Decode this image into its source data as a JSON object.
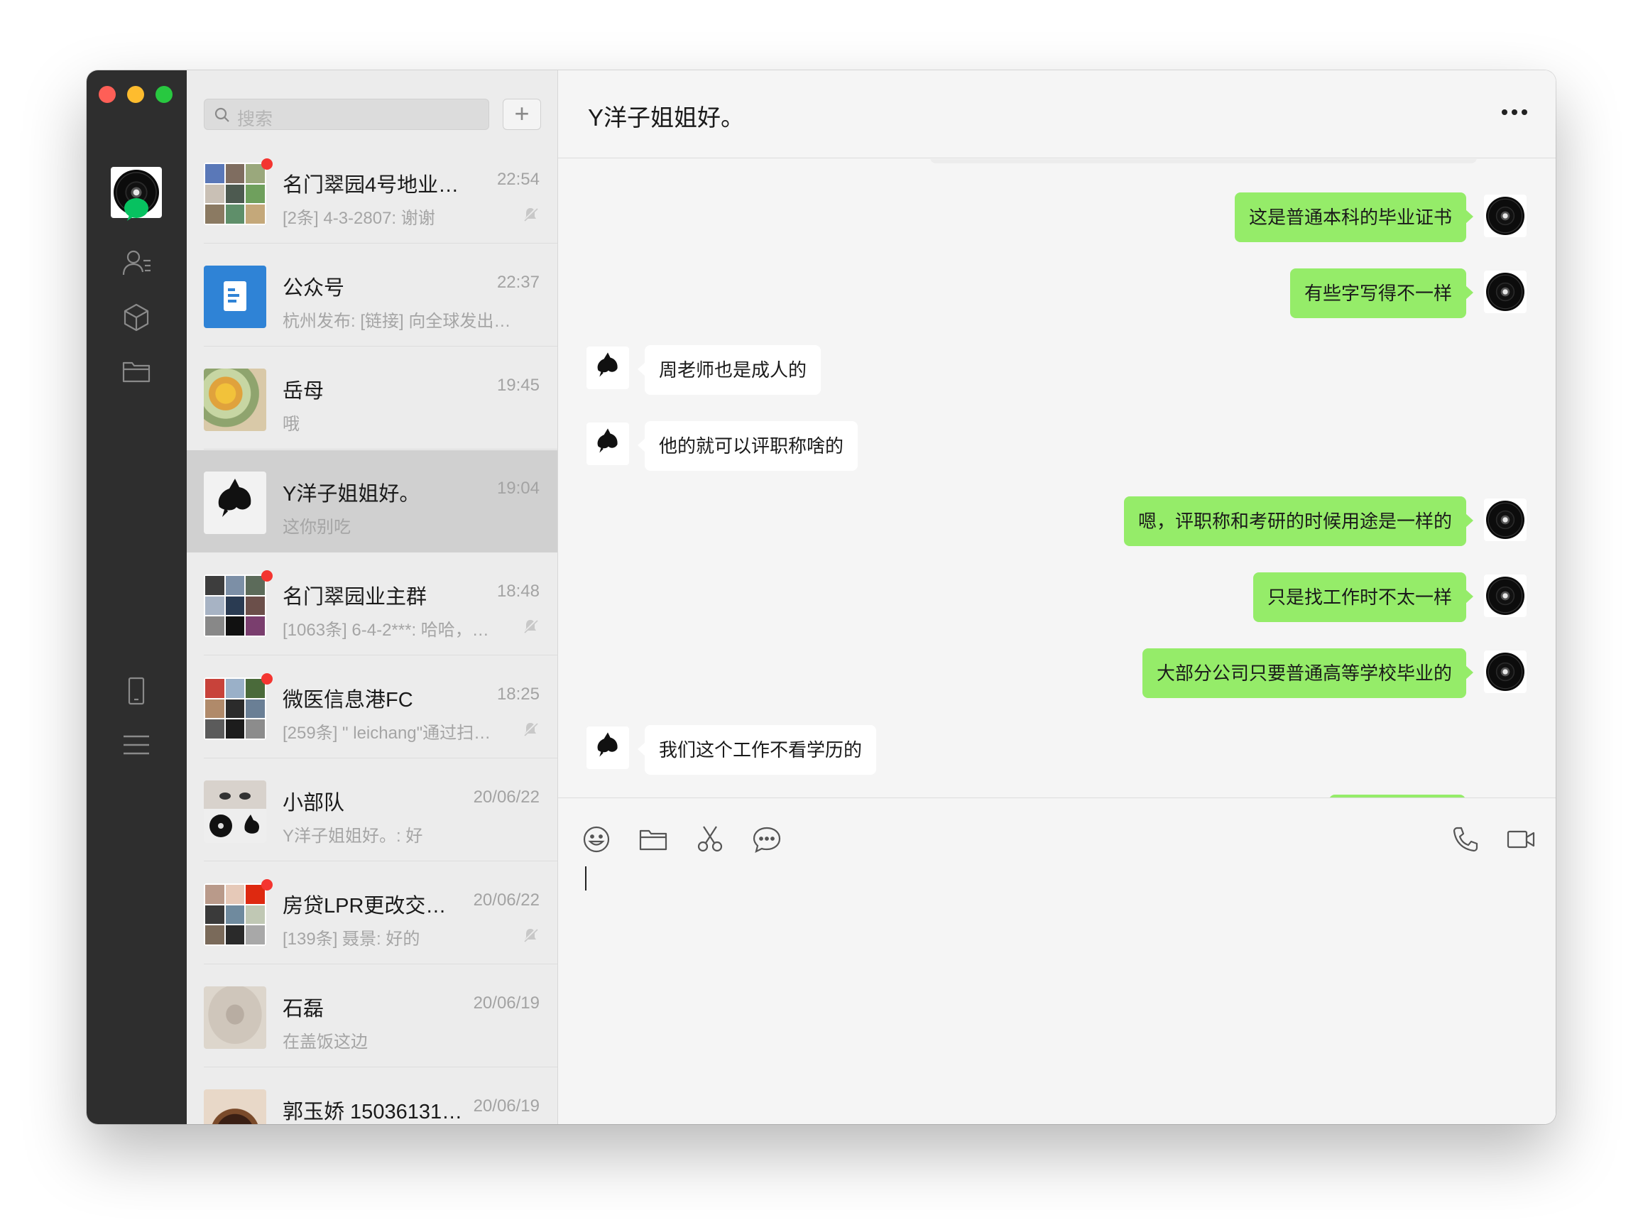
{
  "nav": {
    "items": [
      "chat-icon",
      "contacts-icon",
      "mini-programs-icon",
      "folder-icon",
      "phone-icon",
      "menu-icon"
    ],
    "active_color": "#07c160"
  },
  "search": {
    "placeholder": "搜索"
  },
  "chat_list": [
    {
      "name": "名门翠园4号地业…",
      "time": "22:54",
      "preview": "[2条] 4-3-2807: 谢谢",
      "unread": true,
      "muted": true
    },
    {
      "name": "公众号",
      "time": "22:37",
      "preview": "杭州发布: [链接] 向全球发出真…",
      "unread": false,
      "muted": false
    },
    {
      "name": "岳母",
      "time": "19:45",
      "preview": "哦",
      "unread": false,
      "muted": false
    },
    {
      "name": "Y洋子姐姐好。",
      "time": "19:04",
      "preview": "这你别吃",
      "unread": false,
      "muted": false,
      "selected": true
    },
    {
      "name": "名门翠园业主群",
      "time": "18:48",
      "preview": "[1063条] 6-4-2***: 哈哈，…",
      "unread": true,
      "muted": true
    },
    {
      "name": "微医信息港FC",
      "time": "18:25",
      "preview": "[259条] \" leichang\"通过扫…",
      "unread": true,
      "muted": true
    },
    {
      "name": "小部队",
      "time": "20/06/22",
      "preview": "Y洋子姐姐好。: 好",
      "unread": false,
      "muted": false
    },
    {
      "name": "房贷LPR更改交…",
      "time": "20/06/22",
      "preview": "[139条] 聂景: 好的",
      "unread": true,
      "muted": true
    },
    {
      "name": "石磊",
      "time": "20/06/19",
      "preview": "在盖饭这边",
      "unread": false,
      "muted": false
    },
    {
      "name": "郭玉娇 15036131…",
      "time": "20/06/19",
      "preview": "",
      "unread": false,
      "muted": false
    }
  ],
  "chat": {
    "title": "Y洋子姐姐好。",
    "messages": [
      {
        "dir": "out",
        "text": "这是普通本科的毕业证书"
      },
      {
        "dir": "out",
        "text": "有些字写得不一样"
      },
      {
        "dir": "in",
        "text": "周老师也是成人的"
      },
      {
        "dir": "in",
        "text": "他的就可以评职称啥的"
      },
      {
        "dir": "out",
        "text": "嗯，评职称和考研的时候用途是一样的"
      },
      {
        "dir": "out",
        "text": "只是找工作时不太一样"
      },
      {
        "dir": "out",
        "text": "大部分公司只要普通高等学校毕业的"
      },
      {
        "dir": "in",
        "text": "我们这个工作不看学历的"
      }
    ],
    "bubble_out_color": "#95ec69",
    "bubble_in_color": "#ffffff"
  },
  "composer": {
    "tools": [
      "emoji-icon",
      "file-icon",
      "screenshot-scissors-icon",
      "chat-history-icon"
    ],
    "right_tools": [
      "voice-call-icon",
      "video-call-icon"
    ],
    "input_value": ""
  }
}
